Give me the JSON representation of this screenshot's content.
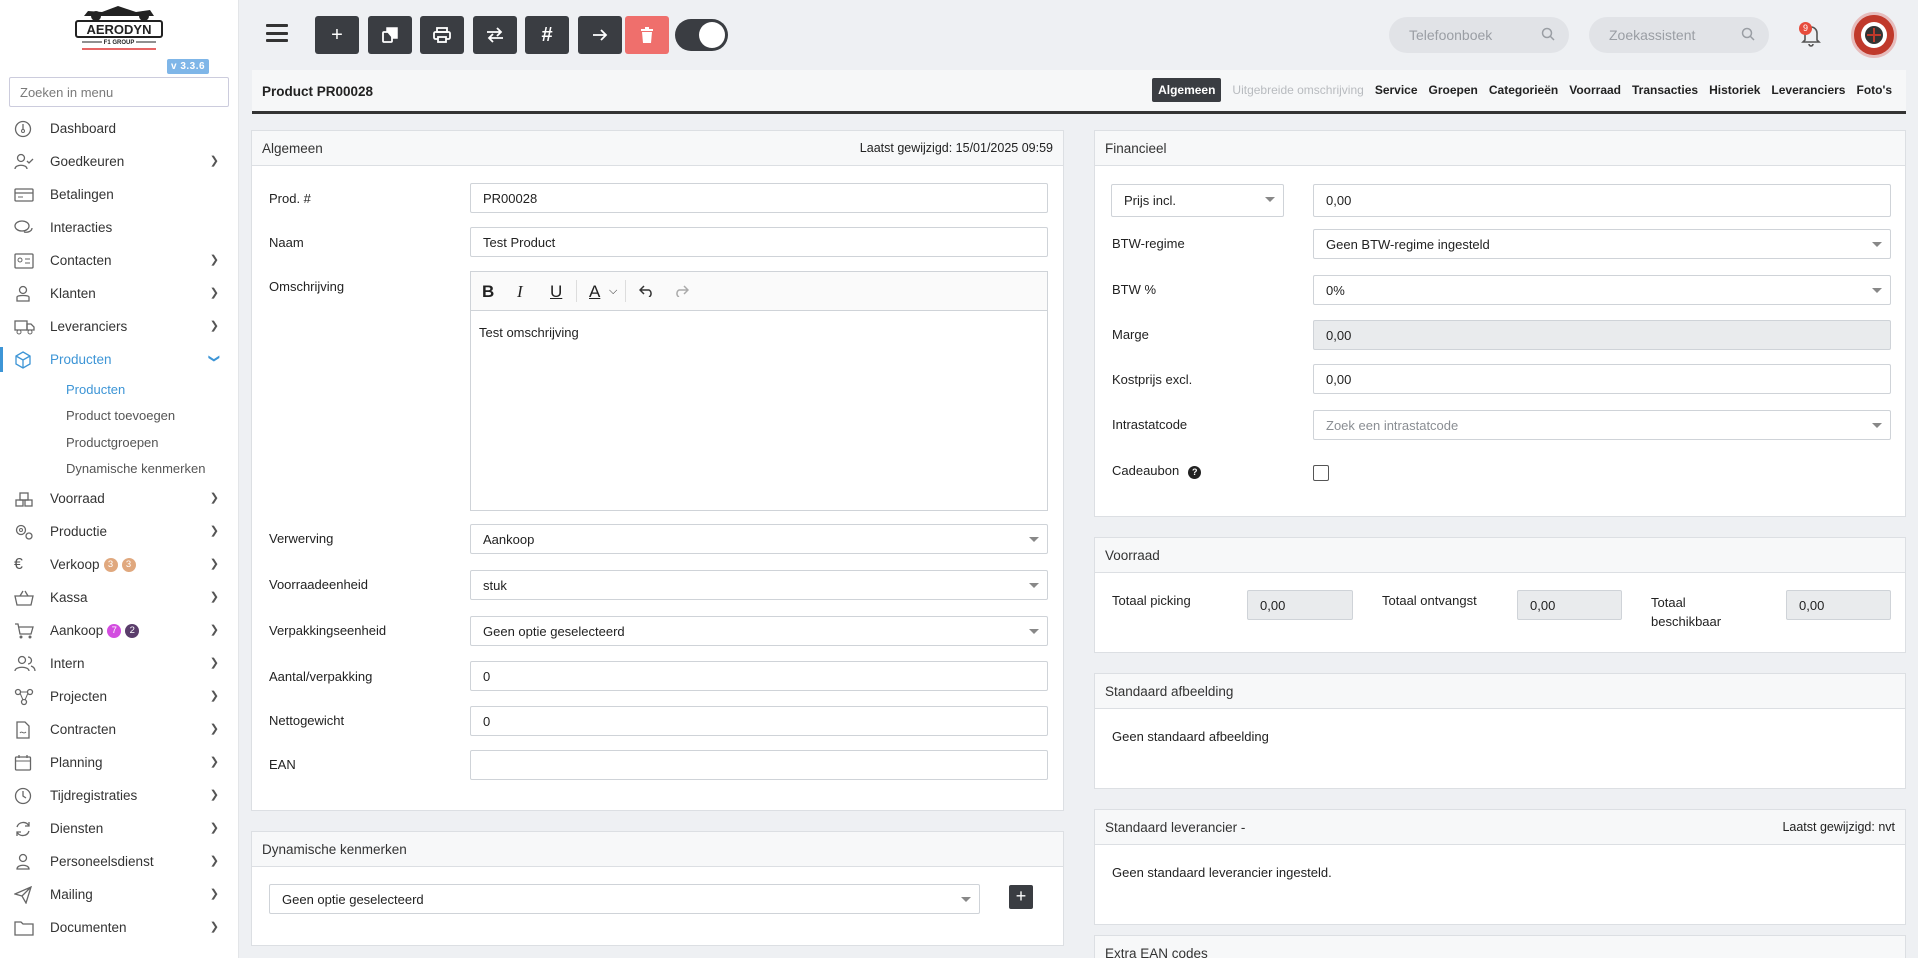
{
  "app": {
    "version": "v 3.3.6",
    "logo_text": "AERODYN",
    "logo_sub": "F1 GROUP"
  },
  "sidebar": {
    "search_placeholder": "Zoeken in menu",
    "items": [
      {
        "label": "Dashboard",
        "icon": "dashboard-icon"
      },
      {
        "label": "Goedkeuren",
        "icon": "user-check-icon"
      },
      {
        "label": "Betalingen",
        "icon": "credit-card-icon"
      },
      {
        "label": "Interacties",
        "icon": "chat-icon"
      },
      {
        "label": "Contacten",
        "icon": "contact-card-icon"
      },
      {
        "label": "Klanten",
        "icon": "customer-icon"
      },
      {
        "label": "Leveranciers",
        "icon": "truck-icon"
      },
      {
        "label": "Producten",
        "icon": "box-icon"
      },
      {
        "label": "Voorraad",
        "icon": "stock-icon"
      },
      {
        "label": "Productie",
        "icon": "gears-icon"
      },
      {
        "label": "Verkoop",
        "icon": "euro-icon",
        "badges": [
          "3",
          "3"
        ]
      },
      {
        "label": "Kassa",
        "icon": "basket-icon"
      },
      {
        "label": "Aankoop",
        "icon": "cart-icon",
        "badges": [
          "7",
          "2"
        ]
      },
      {
        "label": "Intern",
        "icon": "users-icon"
      },
      {
        "label": "Projecten",
        "icon": "network-icon"
      },
      {
        "label": "Contracten",
        "icon": "contract-icon"
      },
      {
        "label": "Planning",
        "icon": "calendar-icon"
      },
      {
        "label": "Tijdregistraties",
        "icon": "clock-icon"
      },
      {
        "label": "Diensten",
        "icon": "refresh-icon"
      },
      {
        "label": "Personeelsdienst",
        "icon": "person-icon"
      },
      {
        "label": "Mailing",
        "icon": "paper-plane-icon"
      },
      {
        "label": "Documenten",
        "icon": "folder-icon"
      }
    ],
    "sub_items": [
      "Producten",
      "Product toevoegen",
      "Productgroepen",
      "Dynamische kenmerken"
    ]
  },
  "topbar": {
    "search1_placeholder": "Telefoonboek",
    "search2_placeholder": "Zoekassistent",
    "notification_count": "9"
  },
  "product": {
    "title": "Product PR00028",
    "tabs": [
      "Algemeen",
      "Uitgebreide omschrijving",
      "Service",
      "Groepen",
      "Categorieën",
      "Voorraad",
      "Transacties",
      "Historiek",
      "Leveranciers",
      "Foto's"
    ]
  },
  "algemeen": {
    "title": "Algemeen",
    "last_modified": "Laatst gewijzigd: 15/01/2025 09:59",
    "prod_label": "Prod. #",
    "prod_value": "PR00028",
    "naam_label": "Naam",
    "naam_value": "Test Product",
    "omschrijving_label": "Omschrijving",
    "omschrijving_value": "Test omschrijving",
    "verwerving_label": "Verwerving",
    "verwerving_value": "Aankoop",
    "voorraadeenheid_label": "Voorraadeenheid",
    "voorraadeenheid_value": "stuk",
    "verpakkingseenheid_label": "Verpakkingseenheid",
    "verpakkingseenheid_value": "Geen optie geselecteerd",
    "aantal_label": "Aantal/verpakking",
    "aantal_value": "0",
    "netto_label": "Nettogewicht",
    "netto_value": "0",
    "ean_label": "EAN",
    "ean_value": ""
  },
  "dynamisch": {
    "title": "Dynamische kenmerken",
    "select_value": "Geen optie geselecteerd"
  },
  "financieel": {
    "title": "Financieel",
    "prijs_select": "Prijs incl.",
    "prijs_value": "0,00",
    "btw_regime_label": "BTW-regime",
    "btw_regime_value": "Geen BTW-regime ingesteld",
    "btw_label": "BTW %",
    "btw_value": "0%",
    "marge_label": "Marge",
    "marge_value": "0,00",
    "kostprijs_label": "Kostprijs excl.",
    "kostprijs_value": "0,00",
    "intrastat_label": "Intrastatcode",
    "intrastat_placeholder": "Zoek een intrastatcode",
    "cadeau_label": "Cadeaubon"
  },
  "voorraad": {
    "title": "Voorraad",
    "picking_label": "Totaal picking",
    "picking_value": "0,00",
    "ontvangst_label": "Totaal ontvangst",
    "ontvangst_value": "0,00",
    "beschikbaar_label1": "Totaal",
    "beschikbaar_label2": "beschikbaar",
    "beschikbaar_value": "0,00"
  },
  "afbeelding": {
    "title": "Standaard afbeelding",
    "text": "Geen standaard afbeelding"
  },
  "leverancier": {
    "title": "Standaard leverancier -",
    "last_modified": "Laatst gewijzigd: nvt",
    "text": "Geen standaard leverancier ingesteld."
  },
  "extra_ean": {
    "title": "Extra EAN codes"
  },
  "colors": {
    "accent": "#3d95d6",
    "dark": "#3a3d42",
    "danger": "#ef6f6c"
  }
}
